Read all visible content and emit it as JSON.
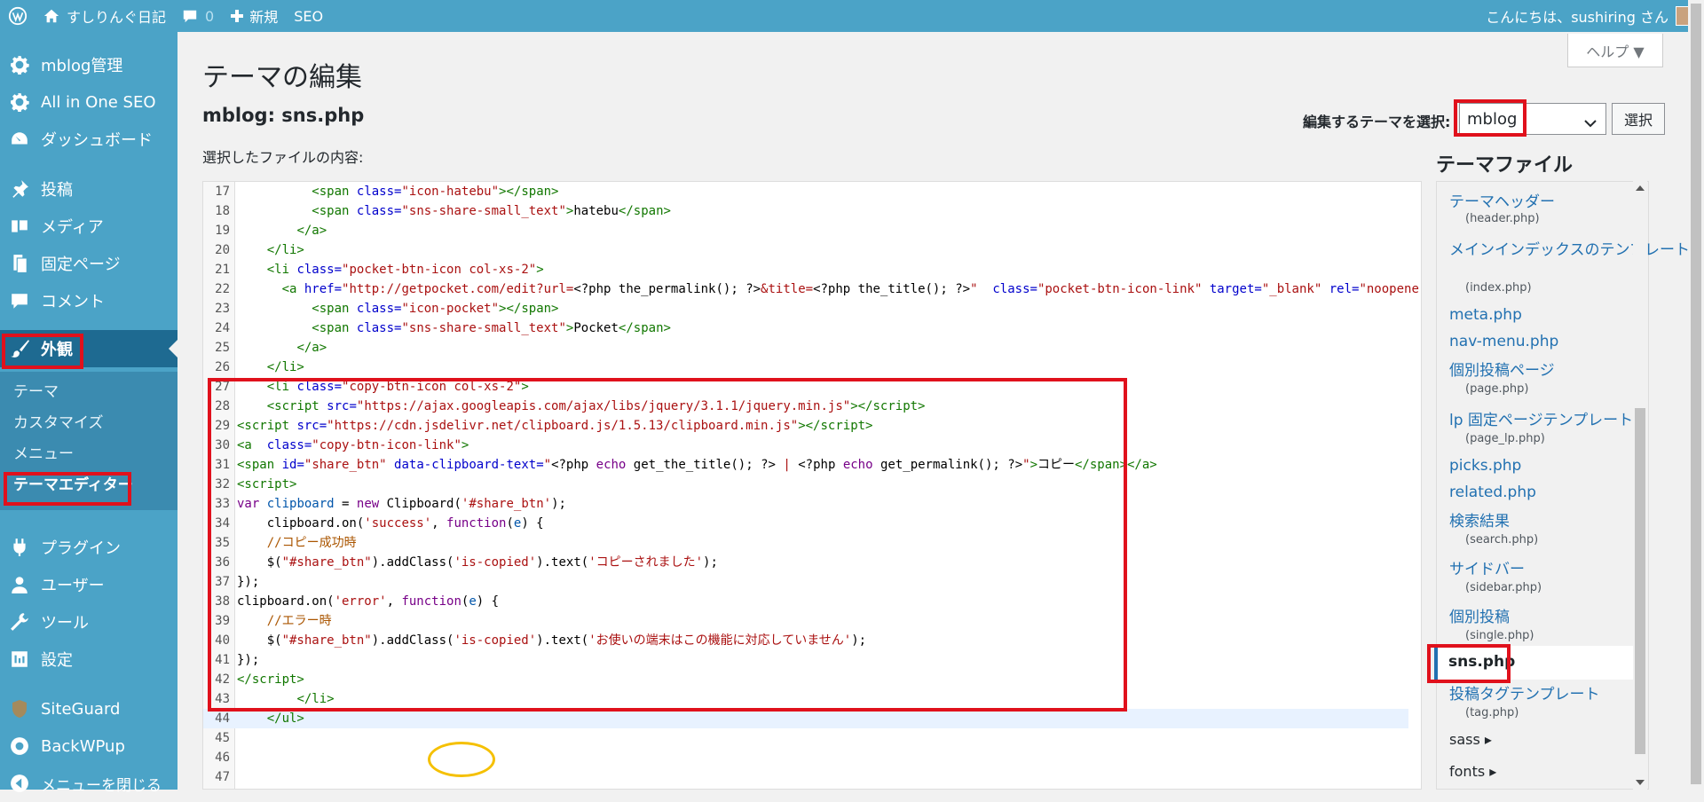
{
  "adminbar": {
    "site_name": "すしりんぐ日記",
    "comments_count": "0",
    "new_label": "新規",
    "seo_label": "SEO",
    "greeting": "こんにちは、sushiring さん"
  },
  "sidebar": {
    "items": [
      {
        "label": "mblog管理",
        "icon": "gear-icon"
      },
      {
        "label": "All in One SEO",
        "icon": "gear-icon"
      },
      {
        "label": "ダッシュボード",
        "icon": "dashboard-icon"
      },
      {
        "label": "投稿",
        "icon": "pin-icon"
      },
      {
        "label": "メディア",
        "icon": "media-icon"
      },
      {
        "label": "固定ページ",
        "icon": "page-icon"
      },
      {
        "label": "コメント",
        "icon": "comment-icon"
      },
      {
        "label": "外観",
        "icon": "brush-icon"
      },
      {
        "label": "プラグイン",
        "icon": "plugin-icon"
      },
      {
        "label": "ユーザー",
        "icon": "user-icon"
      },
      {
        "label": "ツール",
        "icon": "wrench-icon"
      },
      {
        "label": "設定",
        "icon": "settings-icon"
      },
      {
        "label": "SiteGuard",
        "icon": "shield-icon"
      },
      {
        "label": "BackWPup",
        "icon": "backup-icon"
      },
      {
        "label": "メニューを閉じる",
        "icon": "collapse-icon"
      }
    ],
    "submenu": [
      "テーマ",
      "カスタマイズ",
      "メニュー",
      "テーマエディター"
    ]
  },
  "main": {
    "help_label": "ヘルプ ▼",
    "page_title": "テーマの編集",
    "file_title": "mblog: sns.php",
    "content_label": "選択したファイルの内容:",
    "theme_select_label": "編集するテーマを選択:",
    "theme_select_value": "mblog",
    "select_button": "選択"
  },
  "theme_files": {
    "title": "テーマファイル",
    "files": [
      {
        "name": "テーマヘッダー",
        "file": "(header.php)"
      },
      {
        "name": "メインインデックスのテンプレート",
        "file": "(index.php)"
      },
      {
        "name": "meta.php",
        "file": ""
      },
      {
        "name": "nav-menu.php",
        "file": ""
      },
      {
        "name": "個別投稿ページ",
        "file": "(page.php)"
      },
      {
        "name": "lp 固定ページテンプレート",
        "file": "(page_lp.php)"
      },
      {
        "name": "picks.php",
        "file": ""
      },
      {
        "name": "related.php",
        "file": ""
      },
      {
        "name": "検索結果",
        "file": "(search.php)"
      },
      {
        "name": "サイドバー",
        "file": "(sidebar.php)"
      },
      {
        "name": "個別投稿",
        "file": "(single.php)"
      },
      {
        "name": "sns.php",
        "file": ""
      },
      {
        "name": "投稿タグテンプレート",
        "file": "(tag.php)"
      }
    ],
    "folders": [
      "sass",
      "fonts"
    ]
  },
  "colors": {
    "sidebar_bg": "#4ba3c7",
    "current_menu_bg": "#1e6a91",
    "highlight_red": "#e0111c",
    "highlight_yellow": "#f5c000",
    "link_blue": "#2271b1"
  }
}
